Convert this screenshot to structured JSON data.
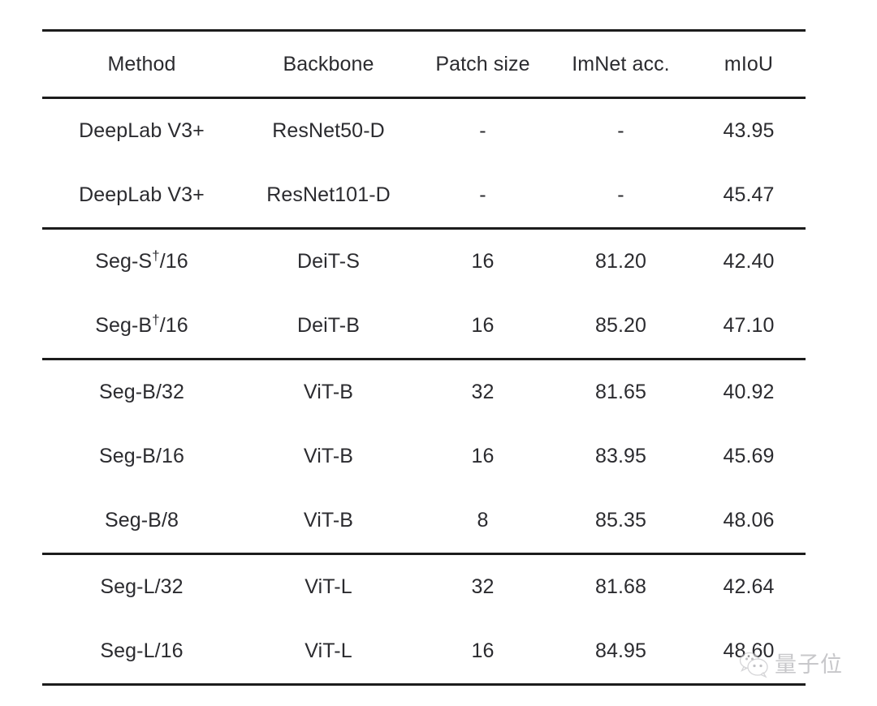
{
  "table": {
    "columns": [
      "Method",
      "Backbone",
      "Patch size",
      "ImNet acc.",
      "mIoU"
    ],
    "groups": [
      {
        "rows": [
          {
            "method": "DeepLab V3+",
            "method_dagger": false,
            "backbone": "ResNet50-D",
            "patch_size": "-",
            "imnet_acc": "-",
            "miou": "43.95",
            "imnet_bold": false,
            "miou_bold": false
          },
          {
            "method": "DeepLab V3+",
            "method_dagger": false,
            "backbone": "ResNet101-D",
            "patch_size": "-",
            "imnet_acc": "-",
            "miou": "45.47",
            "imnet_bold": false,
            "miou_bold": true
          }
        ]
      },
      {
        "rows": [
          {
            "method": "Seg-S",
            "method_dagger": true,
            "method_suffix": "/16",
            "backbone": "DeiT-S",
            "patch_size": "16",
            "imnet_acc": "81.20",
            "miou": "42.40",
            "imnet_bold": false,
            "miou_bold": false
          },
          {
            "method": "Seg-B",
            "method_dagger": true,
            "method_suffix": "/16",
            "backbone": "DeiT-B",
            "patch_size": "16",
            "imnet_acc": "85.20",
            "miou": "47.10",
            "imnet_bold": true,
            "miou_bold": true
          }
        ]
      },
      {
        "rows": [
          {
            "method": "Seg-B/32",
            "method_dagger": false,
            "backbone": "ViT-B",
            "patch_size": "32",
            "imnet_acc": "81.65",
            "miou": "40.92",
            "imnet_bold": false,
            "miou_bold": false
          },
          {
            "method": "Seg-B/16",
            "method_dagger": false,
            "backbone": "ViT-B",
            "patch_size": "16",
            "imnet_acc": "83.95",
            "miou": "45.69",
            "imnet_bold": false,
            "miou_bold": false
          },
          {
            "method": "Seg-B/8",
            "method_dagger": false,
            "backbone": "ViT-B",
            "patch_size": "8",
            "imnet_acc": "85.35",
            "miou": "48.06",
            "imnet_bold": true,
            "miou_bold": true
          }
        ]
      },
      {
        "rows": [
          {
            "method": "Seg-L/32",
            "method_dagger": false,
            "backbone": "ViT-L",
            "patch_size": "32",
            "imnet_acc": "81.68",
            "miou": "42.64",
            "imnet_bold": false,
            "miou_bold": false
          },
          {
            "method": "Seg-L/16",
            "method_dagger": false,
            "backbone": "ViT-L",
            "patch_size": "16",
            "imnet_acc": "84.95",
            "miou": "48.60",
            "imnet_bold": true,
            "miou_bold": true
          }
        ]
      }
    ]
  },
  "watermark": {
    "text": "量子位",
    "icon": "wechat-bubbles-icon",
    "color": "#9a9a9f"
  },
  "style": {
    "background": "#ffffff",
    "text_color": "#2b2b2f",
    "rule_color": "#1c1c1c"
  }
}
